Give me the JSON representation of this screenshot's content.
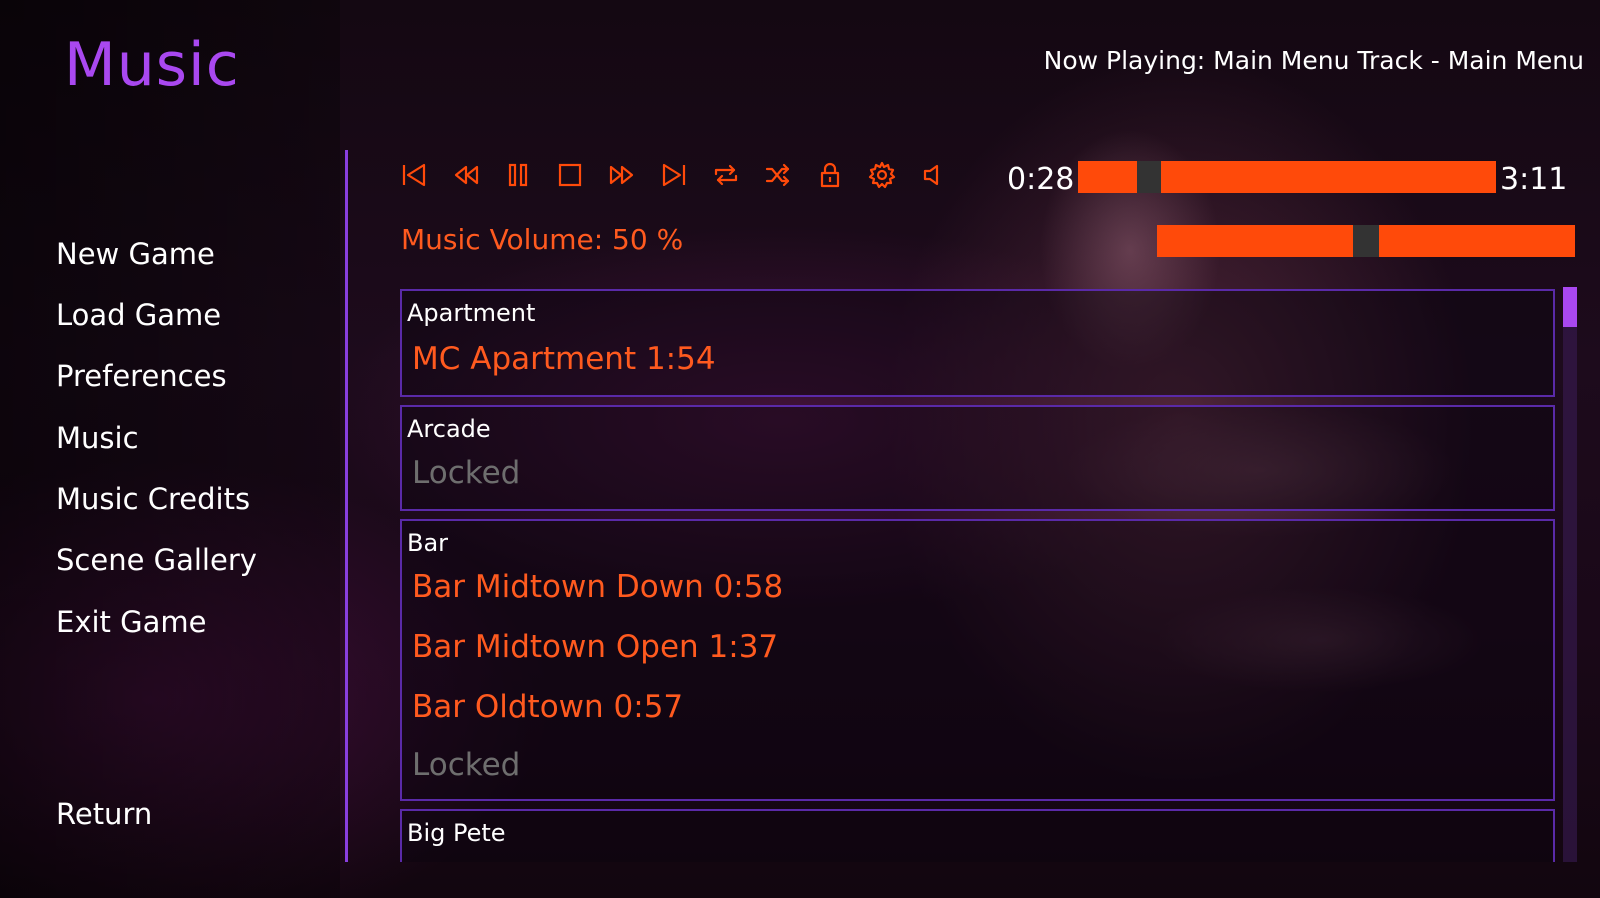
{
  "screen": {
    "title": "Music"
  },
  "nav": {
    "items": [
      {
        "label": "New Game"
      },
      {
        "label": "Load Game"
      },
      {
        "label": "Preferences"
      },
      {
        "label": "Music"
      },
      {
        "label": "Music Credits"
      },
      {
        "label": "Scene Gallery"
      },
      {
        "label": "Exit Game"
      }
    ],
    "return_label": "Return"
  },
  "player": {
    "now_playing": "Now Playing: Main Menu Track - Main Menu",
    "elapsed": "0:28",
    "duration": "3:11",
    "progress_fraction": 0.15,
    "volume_label": "Music Volume: 50 %",
    "volume_fraction": 0.5,
    "controls": [
      {
        "name": "skip-to-start-icon"
      },
      {
        "name": "rewind-icon"
      },
      {
        "name": "pause-icon"
      },
      {
        "name": "stop-icon"
      },
      {
        "name": "fast-forward-icon"
      },
      {
        "name": "skip-to-end-icon"
      },
      {
        "name": "repeat-icon"
      },
      {
        "name": "shuffle-icon"
      },
      {
        "name": "lock-icon"
      },
      {
        "name": "gear-icon"
      },
      {
        "name": "speaker-icon"
      }
    ],
    "accent_color": "#ff4a0a",
    "title_color": "#a948f0"
  },
  "library": {
    "groups": [
      {
        "name": "Apartment",
        "tracks": [
          {
            "label": "MC Apartment 1:54",
            "locked": false
          }
        ]
      },
      {
        "name": "Arcade",
        "tracks": [
          {
            "label": "Locked",
            "locked": true
          }
        ]
      },
      {
        "name": "Bar",
        "tracks": [
          {
            "label": "Bar Midtown Down 0:58",
            "locked": false
          },
          {
            "label": "Bar Midtown Open 1:37",
            "locked": false
          },
          {
            "label": "Bar Oldtown 0:57",
            "locked": false
          },
          {
            "label": "Locked",
            "locked": true
          }
        ]
      },
      {
        "name": "Big Pete",
        "tracks": []
      }
    ]
  }
}
